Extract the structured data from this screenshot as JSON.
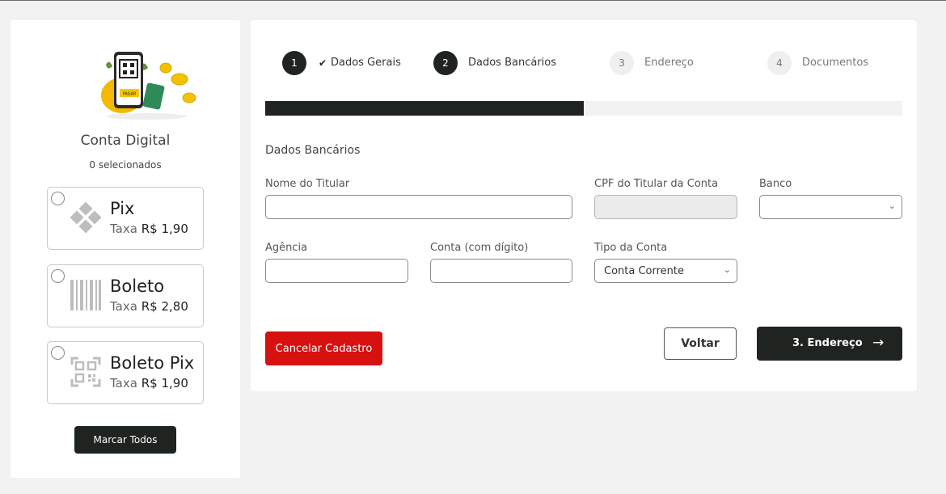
{
  "sidebar": {
    "title": "Conta Digital",
    "selected_count": "0 selecionados",
    "payment_methods": [
      {
        "name": "Pix",
        "fee_label": "Taxa",
        "fee_value": "R$ 1,90",
        "icon": "pix-icon"
      },
      {
        "name": "Boleto",
        "fee_label": "Taxa",
        "fee_value": "R$ 2,80",
        "icon": "barcode-icon"
      },
      {
        "name": "Boleto Pix",
        "fee_label": "Taxa",
        "fee_value": "R$ 1,90",
        "icon": "qr-code-icon"
      }
    ],
    "mark_all_label": "Marcar Todos",
    "illustration_tag": "PAGAR"
  },
  "wizard": {
    "steps": [
      {
        "number": "1",
        "label": "Dados Gerais",
        "state": "done"
      },
      {
        "number": "2",
        "label": "Dados Bancários",
        "state": "active"
      },
      {
        "number": "3",
        "label": "Endereço",
        "state": "pending"
      },
      {
        "number": "4",
        "label": "Documentos",
        "state": "pending"
      }
    ],
    "progress_fraction": 0.5
  },
  "form": {
    "section_title": "Dados Bancários",
    "fields": {
      "holder_name": {
        "label": "Nome do Titular",
        "value": ""
      },
      "holder_cpf": {
        "label": "CPF do Titular da Conta",
        "value": ""
      },
      "bank": {
        "label": "Banco",
        "value": ""
      },
      "agency": {
        "label": "Agência",
        "value": ""
      },
      "account": {
        "label": "Conta (com dígito)",
        "value": ""
      },
      "account_type": {
        "label": "Tipo da Conta",
        "value": "Conta Corrente"
      }
    }
  },
  "actions": {
    "cancel_label": "Cancelar Cadastro",
    "back_label": "Voltar",
    "next_label": "3. Endereço",
    "next_arrow": "→"
  },
  "colors": {
    "dark": "#1f2421",
    "danger": "#d71010",
    "background": "#f2f2f2"
  }
}
